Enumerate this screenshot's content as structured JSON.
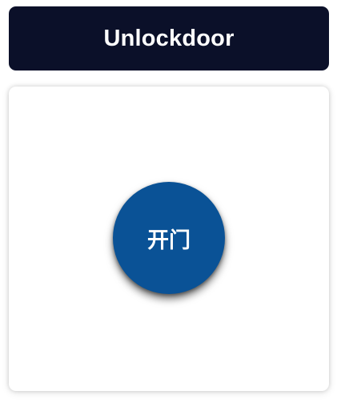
{
  "header": {
    "title": "Unlockdoor"
  },
  "main": {
    "unlock_button_label": "开门"
  },
  "colors": {
    "header_bg": "#0b1029",
    "button_bg": "#0a5296",
    "panel_bg": "#ffffff"
  }
}
